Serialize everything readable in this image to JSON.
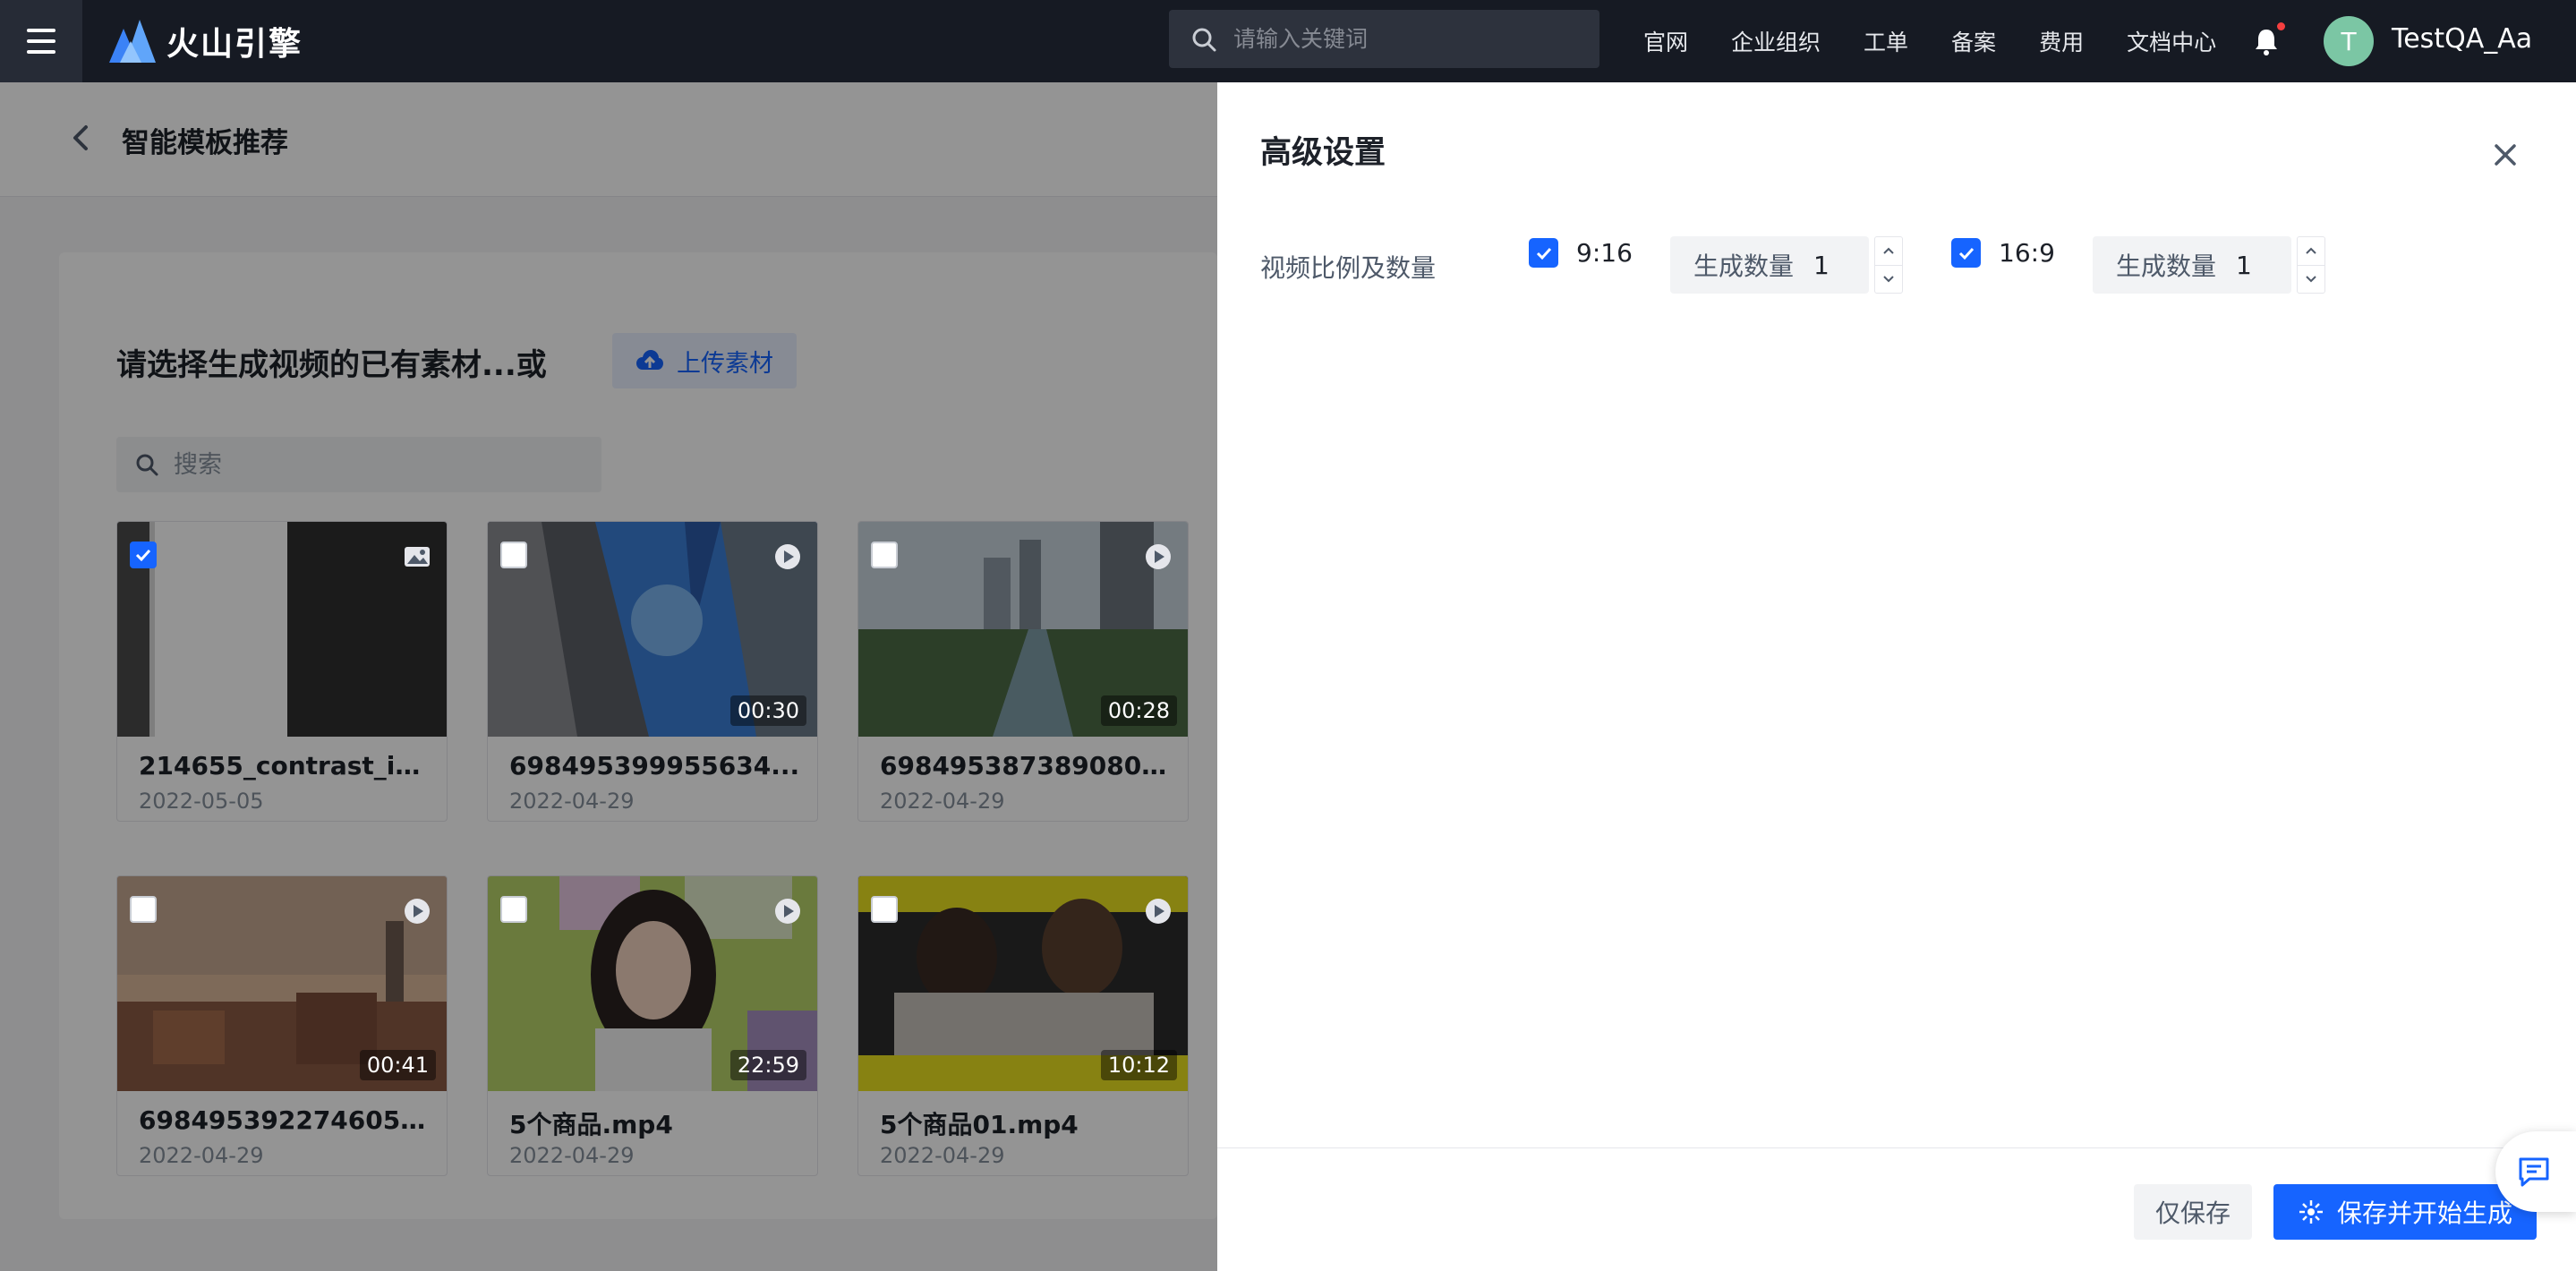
{
  "topbar": {
    "brand": "火山引擎",
    "search_placeholder": "请输入关键词",
    "nav": [
      "官网",
      "企业组织",
      "工单",
      "备案",
      "费用",
      "文档中心"
    ],
    "avatar_initial": "T",
    "username": "TestQA_Aa"
  },
  "page": {
    "title": "智能模板推荐",
    "card_title": "请选择生成视频的已有素材...或",
    "upload_label": "上传素材",
    "search_placeholder": "搜索",
    "materials": [
      {
        "name": "214655_contrast_ico...",
        "date": "2022-05-05",
        "duration": "",
        "type": "image",
        "checked": true
      },
      {
        "name": "698495399955634...",
        "date": "2022-04-29",
        "duration": "00:30",
        "type": "video",
        "checked": false
      },
      {
        "name": "6984953873890804...",
        "date": "2022-04-29",
        "duration": "00:28",
        "type": "video",
        "checked": false
      },
      {
        "name": "6984953922746057...",
        "date": "2022-04-29",
        "duration": "00:41",
        "type": "video",
        "checked": false
      },
      {
        "name": "5个商品.mp4",
        "date": "2022-04-29",
        "duration": "22:59",
        "type": "video",
        "checked": false
      },
      {
        "name": "5个商品01.mp4",
        "date": "2022-04-29",
        "duration": "10:12",
        "type": "video",
        "checked": false
      }
    ]
  },
  "drawer": {
    "title": "高级设置",
    "field_label": "视频比例及数量",
    "ratios": [
      {
        "label": "9:16",
        "checked": true,
        "count_label": "生成数量",
        "count": "1"
      },
      {
        "label": "16:9",
        "checked": true,
        "count_label": "生成数量",
        "count": "1"
      }
    ],
    "save_only": "仅保存",
    "save_and_generate": "保存并开始生成"
  },
  "colors": {
    "accent": "#1664ff",
    "topbar": "#161a23"
  }
}
